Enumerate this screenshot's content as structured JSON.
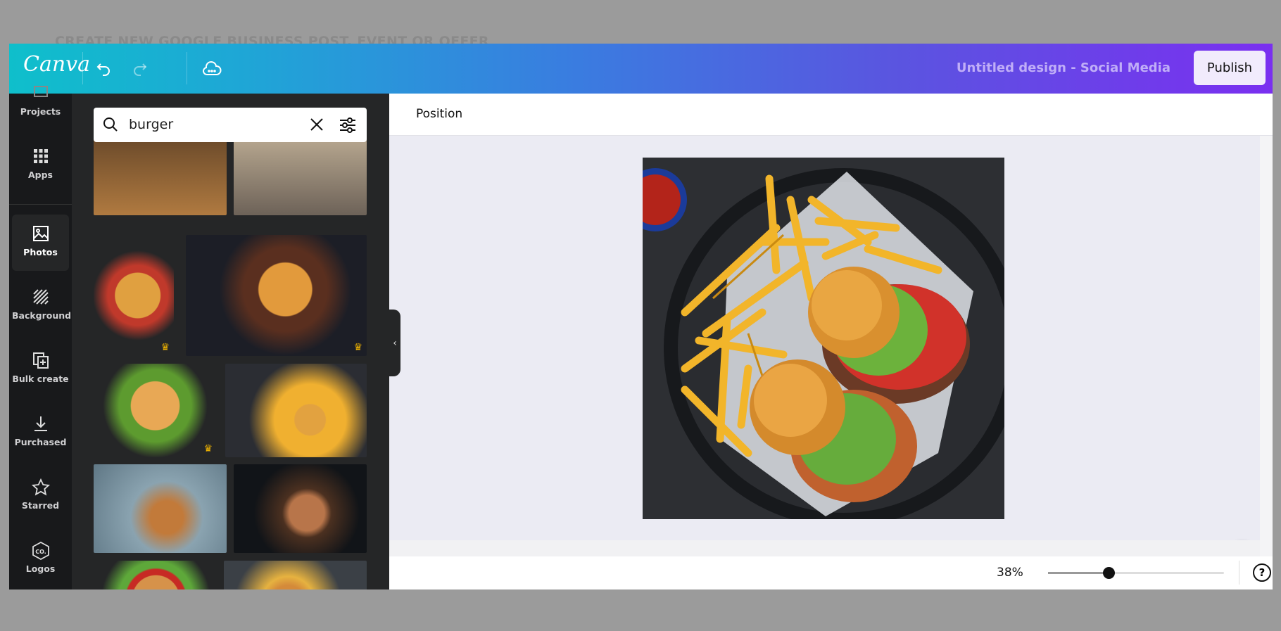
{
  "background": {
    "page_heading": "CREATE NEW GOOGLE BUSINESS POST, EVENT OR OFFER"
  },
  "header": {
    "logo": "Canva",
    "design_title": "Untitled design - Social Media",
    "publish_label": "Publish",
    "icons": [
      "undo-icon",
      "redo-icon",
      "cloud-save-icon"
    ]
  },
  "nav": {
    "items": [
      {
        "label": "Projects",
        "icon": "folder-icon"
      },
      {
        "label": "Apps",
        "icon": "grid-icon"
      },
      {
        "label": "Photos",
        "icon": "image-icon",
        "active": true
      },
      {
        "label": "Background",
        "icon": "stripes-icon"
      },
      {
        "label": "Bulk create",
        "icon": "bulk-create-icon"
      },
      {
        "label": "Purchased",
        "icon": "download-icon"
      },
      {
        "label": "Starred",
        "icon": "star-icon"
      },
      {
        "label": "Logos",
        "icon": "logo-hexagon-icon"
      }
    ]
  },
  "panel": {
    "search_value": "burger",
    "search_icons": [
      "search-icon",
      "clear-icon",
      "filter-icon"
    ],
    "results": [
      {
        "premium": false
      },
      {
        "premium": false
      },
      {
        "premium": true
      },
      {
        "premium": true
      },
      {
        "premium": true
      },
      {
        "premium": false
      },
      {
        "premium": false
      },
      {
        "premium": false
      },
      {
        "premium": false
      },
      {
        "premium": true
      }
    ]
  },
  "editor": {
    "toolbar_label": "Position",
    "zoom_label": "38%",
    "zoom_percent": 38,
    "help_label": "?"
  },
  "colors": {
    "header_start": "#0fbfcb",
    "header_end": "#7a2ff0",
    "nav_bg": "#18191b",
    "panel_bg": "#252627",
    "canvas_bg": "#ebebf3"
  }
}
